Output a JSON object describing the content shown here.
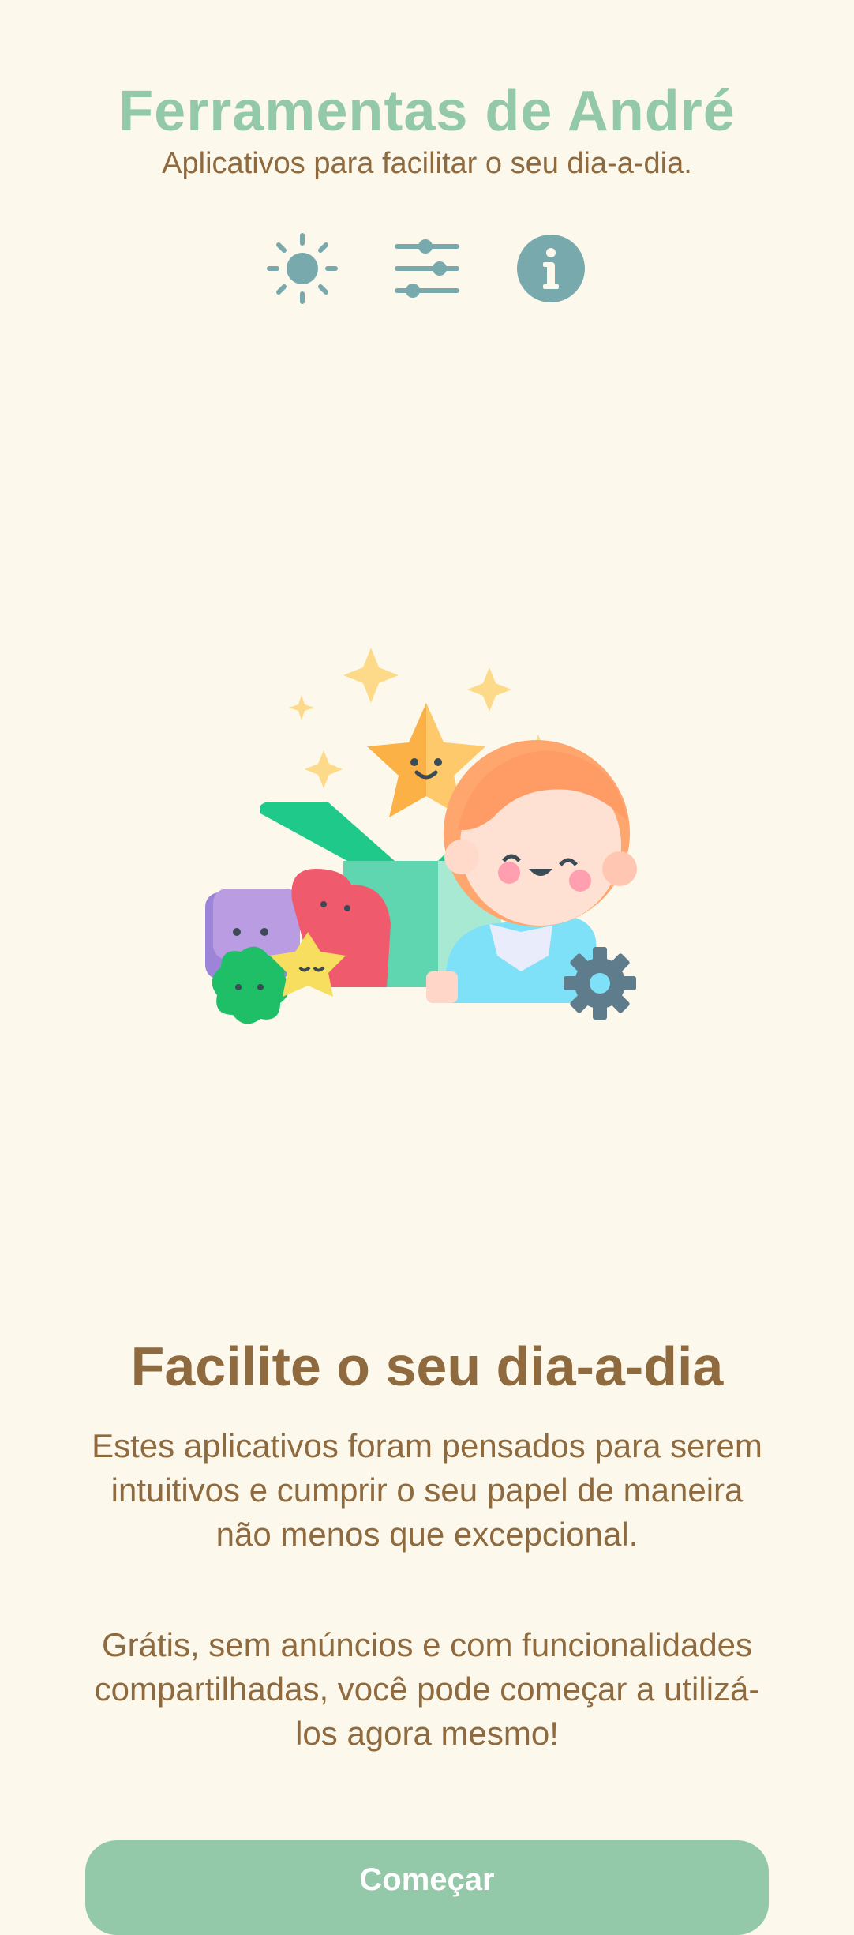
{
  "header": {
    "title": "Ferramentas de André",
    "subtitle": "Aplicativos para facilitar o seu dia-a-dia."
  },
  "toolbar": {
    "buttons": [
      {
        "icon": "sun-icon"
      },
      {
        "icon": "sliders-icon"
      },
      {
        "icon": "info-icon"
      }
    ]
  },
  "illustration": {
    "icon": "toolbox-characters-illustration"
  },
  "hero": {
    "title": "Facilite o seu dia-a-dia",
    "paragraph_1": "Estes aplicativos foram pensados para serem intuitivos e cumprir o seu papel de maneira não menos que excepcional.",
    "paragraph_2": "Grátis, sem anúncios e com funcionalidades compartilhadas, você pode começar a utilizá-los agora mesmo!"
  },
  "cta": {
    "label": "Começar"
  },
  "colors": {
    "background": "#fcf9ec",
    "accent_green": "#93c9a8",
    "text_brown": "#8f6a3f",
    "icon_teal": "#78a9ad"
  }
}
